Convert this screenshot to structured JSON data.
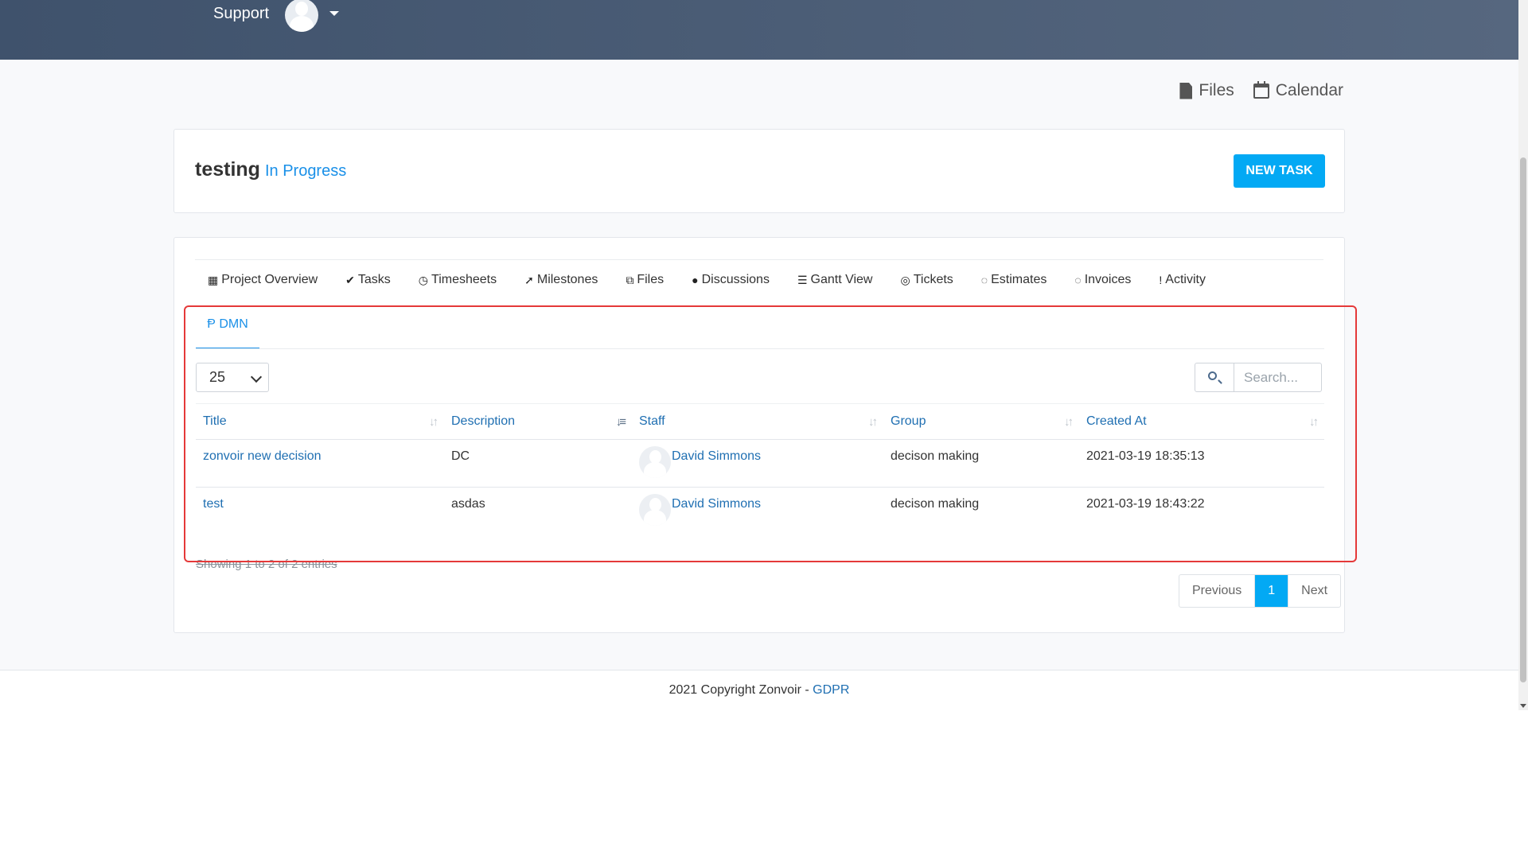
{
  "header": {
    "support_label": "Support"
  },
  "quicklinks": {
    "files": "Files",
    "calendar": "Calendar"
  },
  "project": {
    "title": "testing",
    "status": "In Progress",
    "new_task_label": "NEW TASK"
  },
  "nav": {
    "items": [
      {
        "label": "Project Overview",
        "icon": "grid-icon"
      },
      {
        "label": "Tasks",
        "icon": "check-circle-icon"
      },
      {
        "label": "Timesheets",
        "icon": "clock-icon"
      },
      {
        "label": "Milestones",
        "icon": "rocket-icon"
      },
      {
        "label": "Files",
        "icon": "files-icon"
      },
      {
        "label": "Discussions",
        "icon": "comment-icon"
      },
      {
        "label": "Gantt View",
        "icon": "list-icon"
      },
      {
        "label": "Tickets",
        "icon": "lifebuoy-icon"
      },
      {
        "label": "Estimates",
        "icon": "spinner-icon"
      },
      {
        "label": "Invoices",
        "icon": "spinner-icon"
      },
      {
        "label": "Activity",
        "icon": "exclamation-icon"
      }
    ]
  },
  "subtab": {
    "label": "DMN"
  },
  "table_controls": {
    "page_length": "25",
    "search_placeholder": "Search..."
  },
  "table": {
    "columns": [
      "Title",
      "Description",
      "Staff",
      "Group",
      "Created At"
    ],
    "rows": [
      {
        "title": "zonvoir new decision",
        "description": "DC",
        "staff": "David Simmons",
        "group": "decison making",
        "created_at": "2021-03-19 18:35:13"
      },
      {
        "title": "test",
        "description": "asdas",
        "staff": "David Simmons",
        "group": "decison making",
        "created_at": "2021-03-19 18:43:22"
      }
    ],
    "info": "Showing 1 to 2 of 2 entries"
  },
  "pagination": {
    "previous": "Previous",
    "current": "1",
    "next": "Next"
  },
  "footer": {
    "copyright": "2021 Copyright Zonvoir - ",
    "gdpr": "GDPR"
  },
  "colors": {
    "accent": "#03a9f4",
    "link": "#1f6fb2",
    "highlight": "#e53939"
  }
}
